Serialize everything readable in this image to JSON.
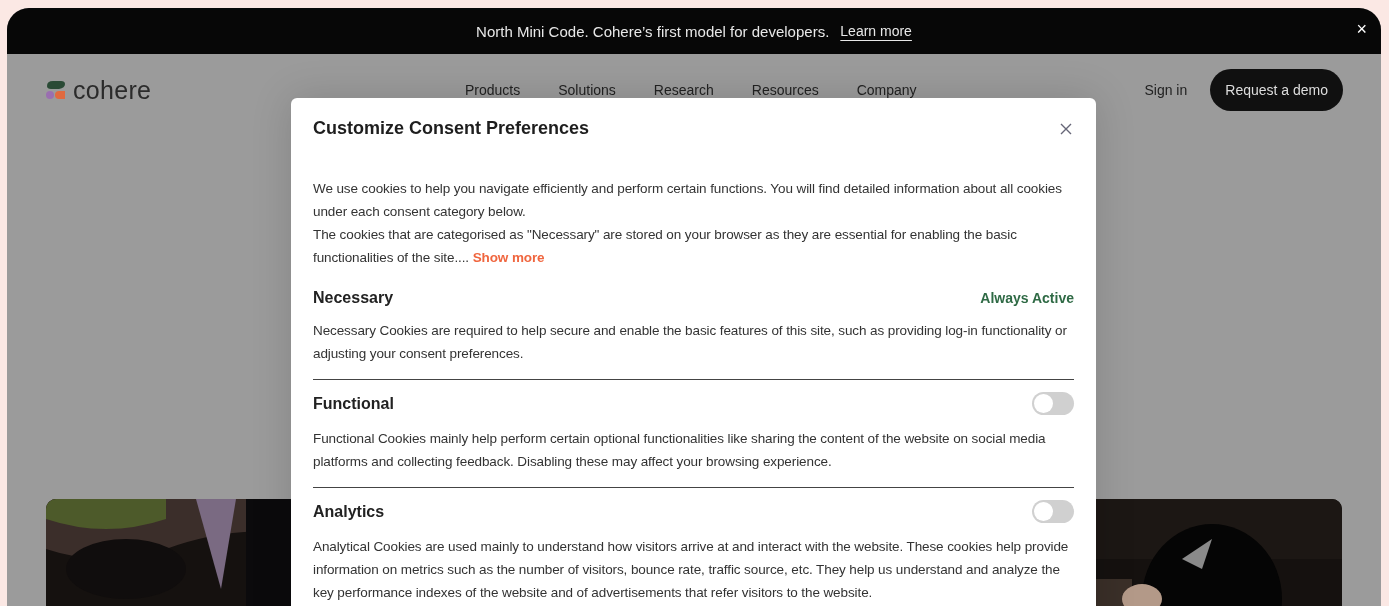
{
  "announcement": {
    "text": "North Mini Code. Cohere’s first model for developers.",
    "link": "Learn more",
    "close": "×"
  },
  "nav": {
    "logo": "cohere",
    "links": [
      "Products",
      "Solutions",
      "Research",
      "Resources",
      "Company"
    ],
    "sign_in": "Sign in",
    "cta": "Request a demo"
  },
  "dialog": {
    "title": "Customize Consent Preferences",
    "intro": [
      "We use cookies to help you navigate efficiently and perform certain functions. You will find detailed information about all cookies under each consent category below.",
      "The cookies that are categorised as \"Necessary\" are stored on your browser as they are essential for enabling the basic functionalities of the site...."
    ],
    "show_more": "Show more",
    "categories": [
      {
        "kind": "always_active",
        "name": "Necessary",
        "status": "Always Active",
        "description": "Necessary Cookies are required to help secure and enable the basic features of this site, such as providing log-in functionality or adjusting your consent preferences."
      },
      {
        "kind": "toggle",
        "name": "Functional",
        "on": false,
        "description": "Functional Cookies mainly help perform certain optional functionalities like sharing the content of the website on social media platforms and collecting feedback. Disabling these may affect your browsing experience."
      },
      {
        "kind": "toggle",
        "name": "Analytics",
        "on": false,
        "description": "Analytical Cookies are used mainly to understand how visitors arrive at and interact with the website. These cookies help provide information on metrics such as the number of visitors, bounce rate, traffic source, etc. They help us understand and analyze the key performance indexes of the website and of advertisements that refer visitors to the website."
      }
    ]
  }
}
